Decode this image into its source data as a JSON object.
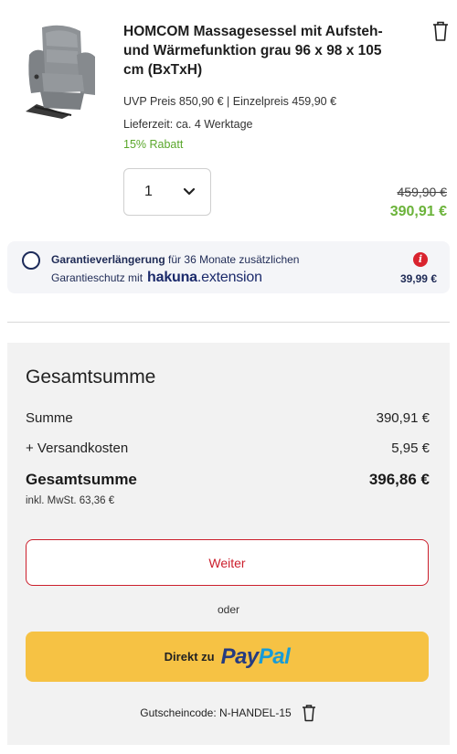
{
  "product": {
    "image_alt": "grey recliner massage chair",
    "title": "HOMCOM Massagesessel mit Aufsteh- und Wärmefunktion grau 96 x 98 x 105 cm (BxTxH)",
    "uvp_line": "UVP Preis  850,90 € | Einzelpreis  459,90 €",
    "lieferzeit": "Lieferzeit:  ca. 4 Werktage",
    "rabatt": "15% Rabatt",
    "quantity": "1",
    "price_old": "459,90 €",
    "price_new": "390,91 €",
    "icons": {
      "remove": "trash-icon",
      "quantity": "chevron-down-icon"
    }
  },
  "guarantee": {
    "line1_bold": "Garantieverlängerung",
    "line1_rest": " für 36 Monate zusätzlichen",
    "line2_text": "Garantieschutz mit",
    "logo_part1": "hakuna",
    "logo_part2": ".extension",
    "info_glyph": "i",
    "price": "39,99 €",
    "colors": {
      "logo": "#1b2a6b",
      "info": "#d9232e"
    }
  },
  "summary": {
    "heading": "Gesamtsumme",
    "summe_label": "Summe",
    "summe_value": "390,91 €",
    "versand_label": "+ Versandkosten",
    "versand_value": "5,95 €",
    "total_label": "Gesamtsumme",
    "total_value": "396,86 €",
    "mwst": "inkl. MwSt. 63,36 €",
    "weiter_label": "Weiter",
    "oder": "oder",
    "paypal_prefix": "Direkt zu",
    "paypal_logo_a": "Pay",
    "paypal_logo_b": "Pal",
    "voucher_text": "Gutscheincode: N-HANDEL-15",
    "colors": {
      "accent": "#cc1f2c",
      "paypal_bg": "#f6c244",
      "discount": "#6bb33a"
    }
  }
}
